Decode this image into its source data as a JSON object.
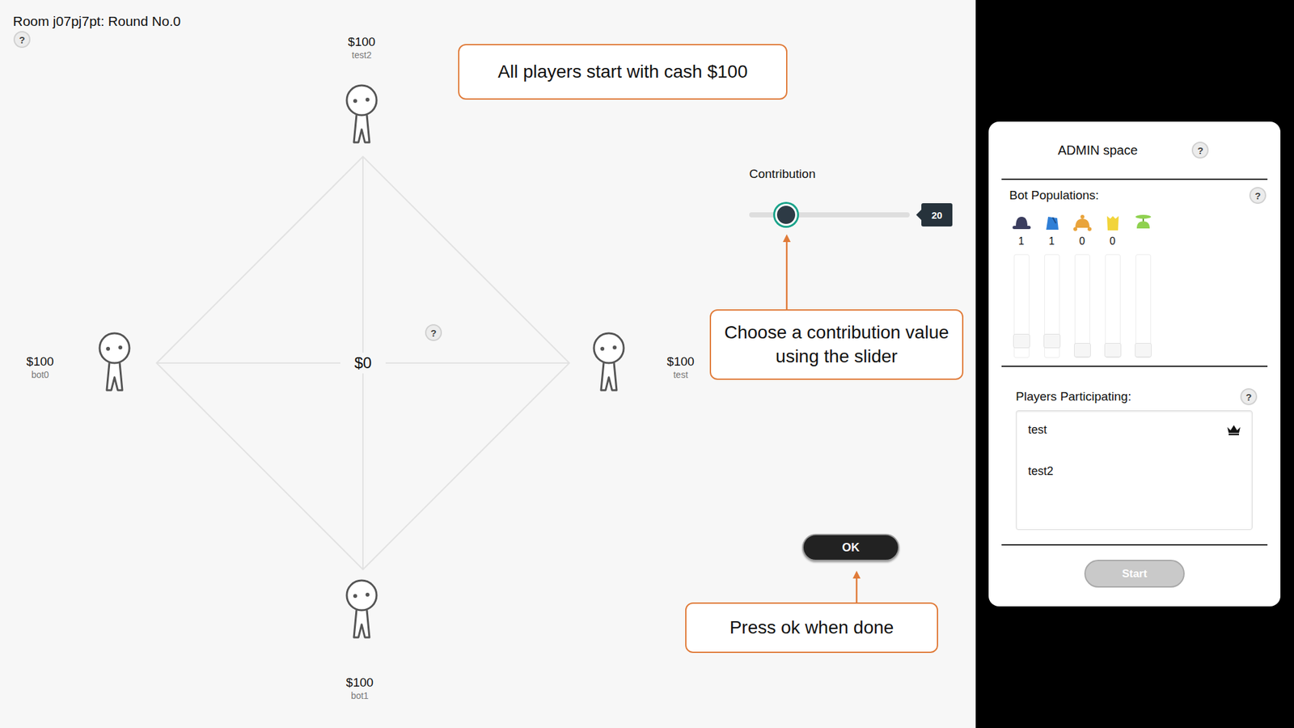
{
  "room": {
    "title": "Room j07pj7pt: Round No.0",
    "help": "?"
  },
  "notes": [
    {
      "text": "All players start with cash $100"
    },
    {
      "text": "Choose a contribution value using the slider"
    },
    {
      "text": "Press ok when done"
    }
  ],
  "pot": {
    "amount": "$0",
    "help": "?"
  },
  "players": [
    {
      "name": "test2",
      "cash": "$100"
    },
    {
      "name": "bot0",
      "cash": "$100"
    },
    {
      "name": "test",
      "cash": "$100"
    },
    {
      "name": "bot1",
      "cash": "$100"
    }
  ],
  "contribution": {
    "label": "Contribution",
    "value": "20",
    "level": 0.23
  },
  "ok_button": {
    "label": "OK"
  },
  "admin": {
    "title": "ADMIN space",
    "help": "?",
    "bot_populations": {
      "label": "Bot Populations:",
      "help": "?",
      "bots": [
        {
          "kind": "bowler",
          "color": "#3b3d5e",
          "count": "1",
          "level": 0.1
        },
        {
          "kind": "fez",
          "color": "#2f7fd6",
          "count": "1",
          "level": 0.1
        },
        {
          "kind": "deerstalker",
          "color": "#e9a43c",
          "count": "0",
          "level": 0
        },
        {
          "kind": "tophat",
          "color": "#f2d43a",
          "count": "0",
          "level": 0
        },
        {
          "kind": "propeller",
          "color": "#8fd14f",
          "level": 0
        }
      ]
    },
    "players": {
      "label": "Players Participating:",
      "help": "?",
      "items": [
        {
          "name": "test",
          "host": true
        },
        {
          "name": "test2",
          "host": false
        }
      ]
    },
    "start_button": {
      "label": "Start",
      "disabled": true
    }
  }
}
